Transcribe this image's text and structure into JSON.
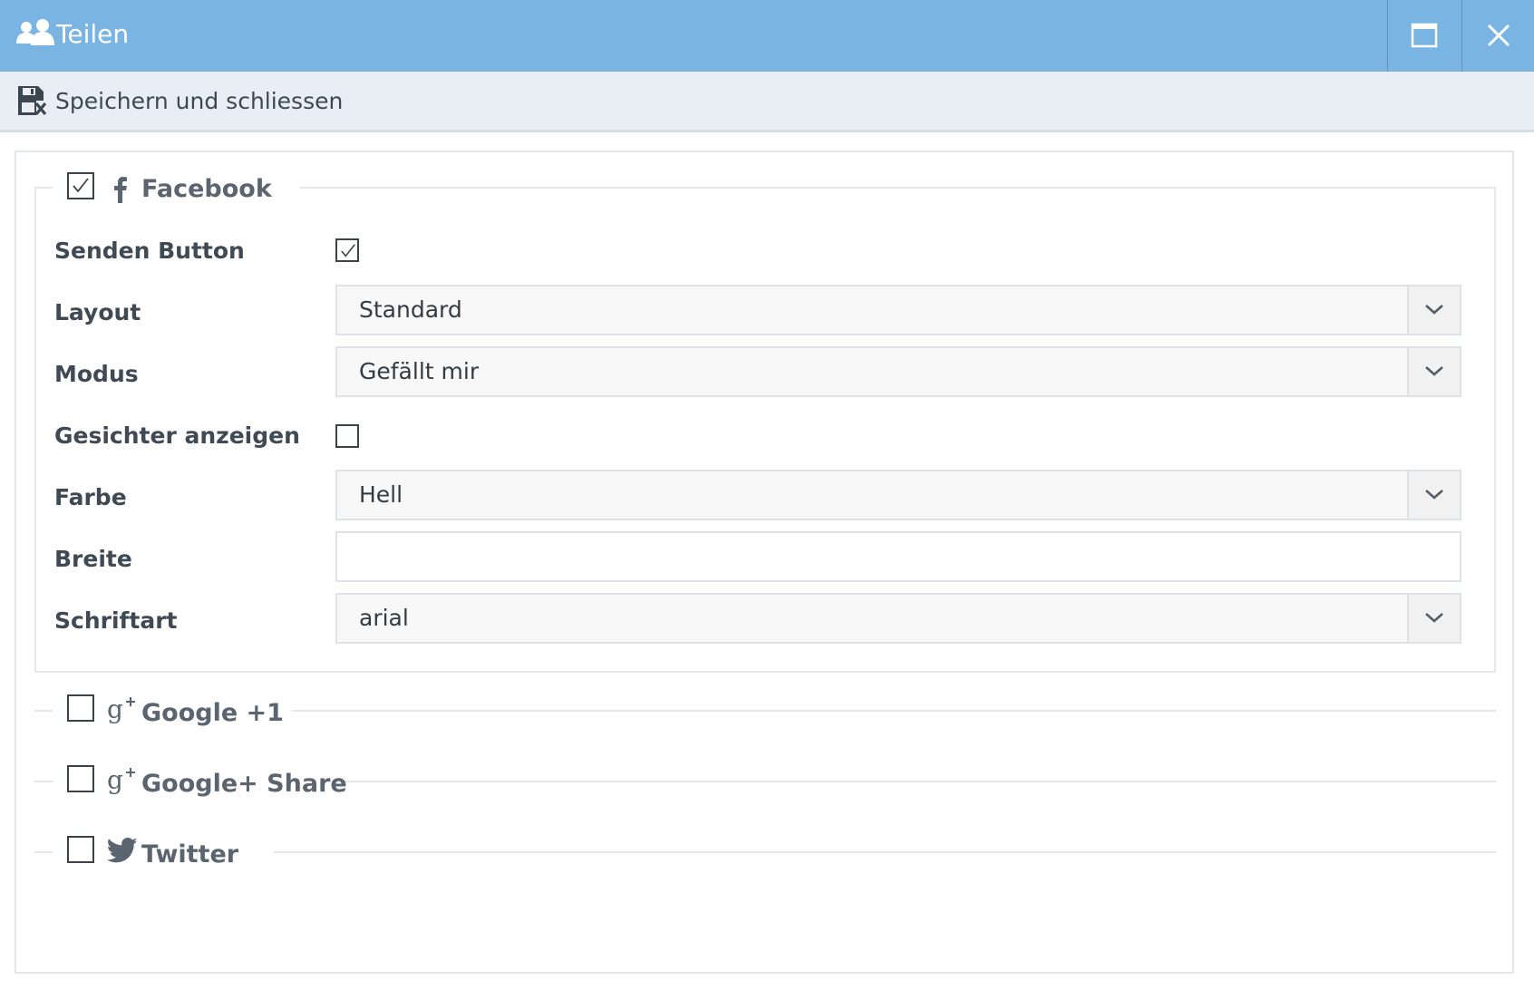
{
  "window": {
    "title": "Teilen",
    "title_icon": "users-icon",
    "buttons": [
      "maximize-icon",
      "close-icon"
    ]
  },
  "toolbar": {
    "save_close_label": "Speichern und schliessen",
    "save_close_icon": "save-close-icon"
  },
  "sections": {
    "facebook": {
      "label": "Facebook",
      "icon": "facebook-icon",
      "checked": true,
      "fields": {
        "send_button": {
          "label": "Senden Button",
          "checked": true
        },
        "layout": {
          "label": "Layout",
          "value": "Standard"
        },
        "mode": {
          "label": "Modus",
          "value": "Gefällt mir"
        },
        "show_faces": {
          "label": "Gesichter anzeigen",
          "checked": false
        },
        "color": {
          "label": "Farbe",
          "value": "Hell"
        },
        "width": {
          "label": "Breite",
          "value": ""
        },
        "font": {
          "label": "Schriftart",
          "value": "arial"
        }
      }
    },
    "google_plus_one": {
      "label": "Google +1",
      "icon": "google-plus-icon",
      "checked": false
    },
    "google_plus_share": {
      "label": "Google+ Share",
      "icon": "google-plus-icon",
      "checked": false
    },
    "twitter": {
      "label": "Twitter",
      "icon": "twitter-icon",
      "checked": false
    }
  },
  "colors": {
    "titlebar": "#7ab4e2",
    "toolbar": "#e9eef4",
    "text": "#3f4a55"
  }
}
